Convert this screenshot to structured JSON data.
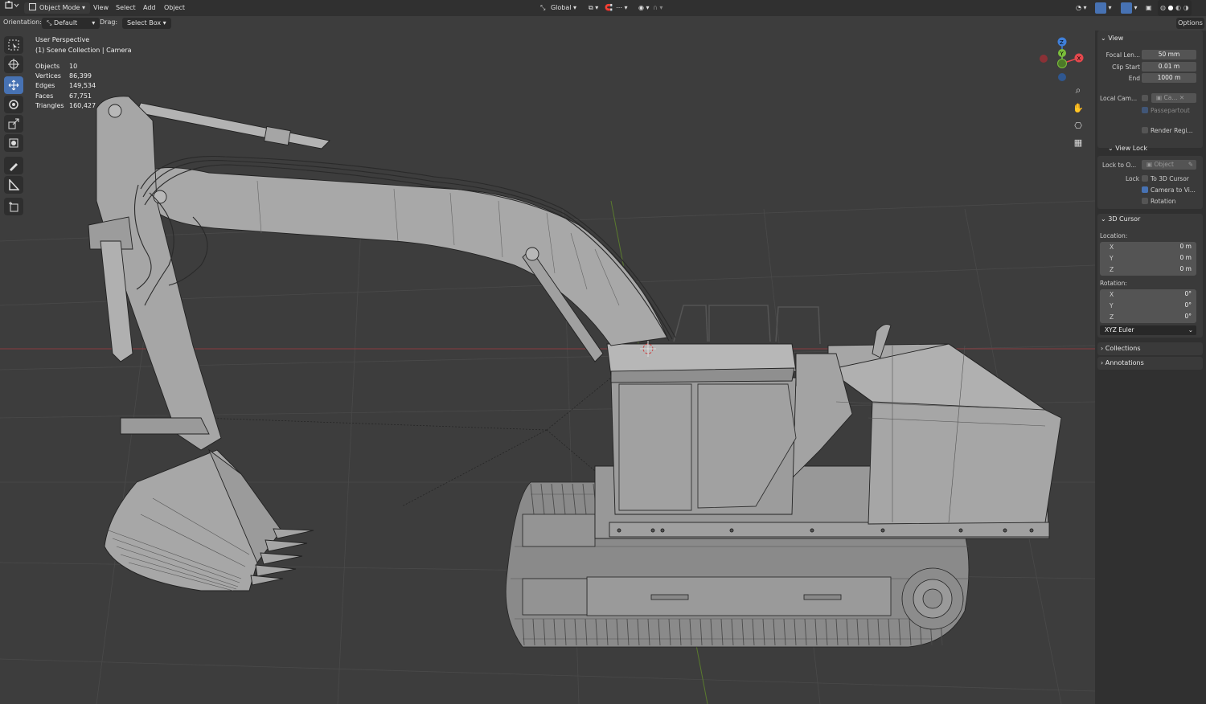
{
  "header": {
    "mode_label": "Object Mode",
    "menu": [
      "View",
      "Select",
      "Add",
      "Object"
    ],
    "transform_orientation": "Global",
    "options_label": "Options"
  },
  "tool_header": {
    "orientation_label": "Orientation:",
    "orientation_value": "Default",
    "drag_label": "Drag:",
    "drag_value": "Select Box"
  },
  "viewport": {
    "perspective": "User Perspective",
    "collection": "(1) Scene Collection | Camera",
    "stats": [
      {
        "label": "Objects",
        "value": "10"
      },
      {
        "label": "Vertices",
        "value": "86,399"
      },
      {
        "label": "Edges",
        "value": "149,534"
      },
      {
        "label": "Faces",
        "value": "67,751"
      },
      {
        "label": "Triangles",
        "value": "160,427"
      }
    ],
    "gizmo": {
      "x": "X",
      "y": "Y",
      "z": "Z"
    }
  },
  "toolbar_tools": [
    "select-box-icon",
    "cursor-icon",
    "move-icon",
    "rotate-icon",
    "scale-icon",
    "transform-icon",
    "annotate-icon",
    "measure-icon",
    "add-cube-icon"
  ],
  "nav_icons": [
    "zoom-icon",
    "pan-hand-icon",
    "camera-view-icon",
    "grid-ortho-icon"
  ],
  "sidebar": {
    "view": {
      "title": "View",
      "focal_length_label": "Focal Len...",
      "focal_length": "50 mm",
      "clip_start_label": "Clip Start",
      "clip_start": "0.01 m",
      "clip_end_label": "End",
      "clip_end": "1000 m",
      "local_camera_label": "Local Cam...",
      "local_camera_value": "Ca...",
      "passepartout_label": "Passepartout",
      "render_region_label": "Render Regi..."
    },
    "view_lock": {
      "title": "View Lock",
      "lock_to_label": "Lock to O...",
      "lock_to_placeholder": "Object",
      "lock_label": "Lock",
      "to_cursor_label": "To 3D Cursor",
      "camera_to_view_label": "Camera to Vi...",
      "rotation_label": "Rotation"
    },
    "cursor": {
      "title": "3D Cursor",
      "location_label": "Location:",
      "loc": [
        {
          "axis": "X",
          "value": "0 m"
        },
        {
          "axis": "Y",
          "value": "0 m"
        },
        {
          "axis": "Z",
          "value": "0 m"
        }
      ],
      "rotation_label": "Rotation:",
      "rot": [
        {
          "axis": "X",
          "value": "0°"
        },
        {
          "axis": "Y",
          "value": "0°"
        },
        {
          "axis": "Z",
          "value": "0°"
        }
      ],
      "rotation_mode": "XYZ Euler"
    },
    "collections_title": "Collections",
    "annotations_title": "Annotations"
  },
  "colors": {
    "accent": "#4772b3",
    "x_axis": "#e5484d",
    "y_axis": "#7bbf3b",
    "z_axis": "#3f7fd9",
    "viewport_bg": "#3d3d3d"
  }
}
